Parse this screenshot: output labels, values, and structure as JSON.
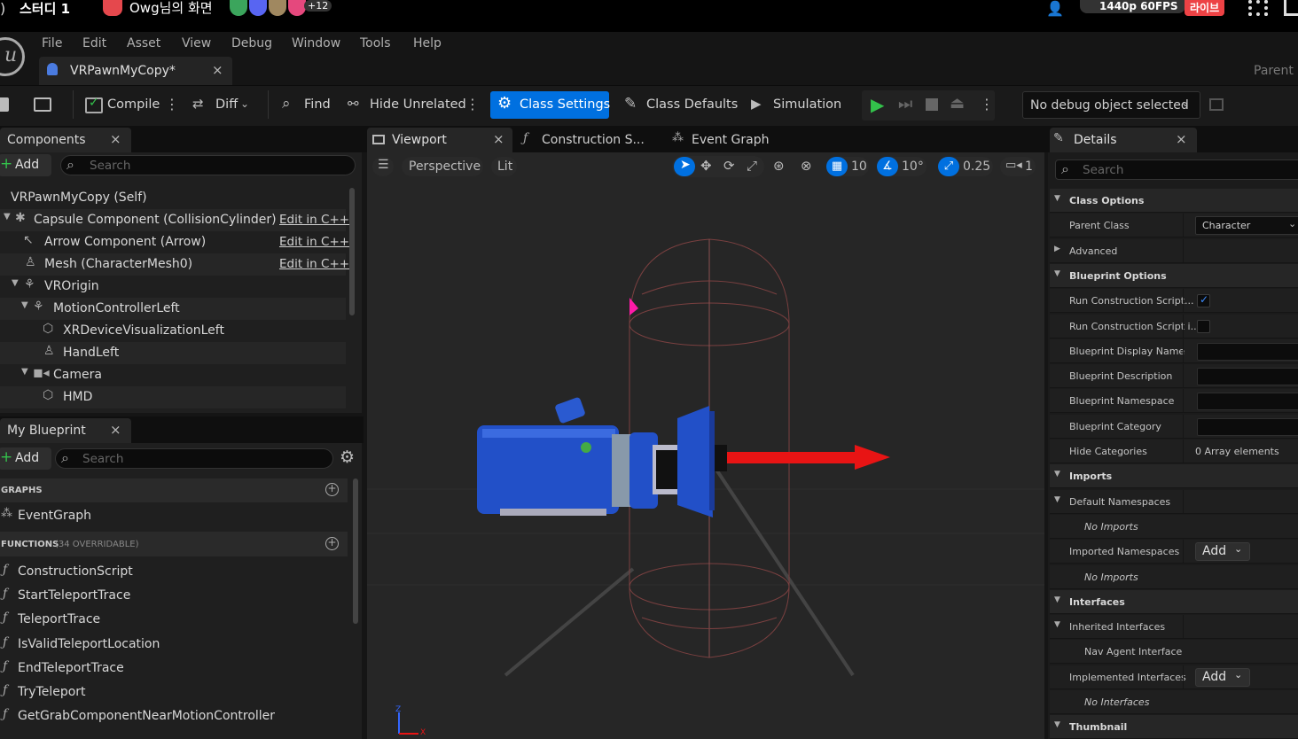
{
  "discord": {
    "channel": "스터디 1",
    "screen_label": "Owg님의 화면",
    "viewer_count": "+12",
    "quality_badge": "1440p 60FPS",
    "live_badge": "라이브"
  },
  "menu": {
    "items": [
      "File",
      "Edit",
      "Asset",
      "View",
      "Debug",
      "Window",
      "Tools",
      "Help"
    ]
  },
  "doc_tab": {
    "label": "VRPawnMyCopy*",
    "close": "×",
    "parent_label": "Parent c"
  },
  "toolbar": {
    "compile": "Compile",
    "diff": "Diff",
    "find": "Find",
    "hide_unrelated": "Hide Unrelated",
    "class_settings": "Class Settings",
    "class_defaults": "Class Defaults",
    "simulation": "Simulation",
    "debug_object": "No debug object selected"
  },
  "components_panel": {
    "title": "Components",
    "close": "×",
    "add": "Add",
    "search_placeholder": "Search",
    "items": [
      {
        "label": "VRPawnMyCopy (Self)",
        "edit": ""
      },
      {
        "label": "Capsule Component (CollisionCylinder)",
        "edit": "Edit in C++"
      },
      {
        "label": "Arrow Component (Arrow)",
        "edit": "Edit in C++"
      },
      {
        "label": "Mesh (CharacterMesh0)",
        "edit": "Edit in C++"
      },
      {
        "label": "VROrigin",
        "edit": ""
      },
      {
        "label": "MotionControllerLeft",
        "edit": ""
      },
      {
        "label": "XRDeviceVisualizationLeft",
        "edit": ""
      },
      {
        "label": "HandLeft",
        "edit": ""
      },
      {
        "label": "Camera",
        "edit": ""
      },
      {
        "label": "HMD",
        "edit": ""
      }
    ]
  },
  "my_blueprint": {
    "title": "My Blueprint",
    "close": "×",
    "add": "Add",
    "search_placeholder": "Search",
    "graphs_header": "GRAPHS",
    "event_graph": "EventGraph",
    "functions_header": "FUNCTIONS",
    "functions_count": "(34 OVERRIDABLE)",
    "functions": [
      "ConstructionScript",
      "StartTeleportTrace",
      "TeleportTrace",
      "IsValidTeleportLocation",
      "EndTeleportTrace",
      "TryTeleport",
      "GetGrabComponentNearMotionController"
    ]
  },
  "editor_tabs": {
    "viewport": "Viewport",
    "close": "×",
    "construction": "Construction S...",
    "event_graph": "Event Graph"
  },
  "viewport": {
    "perspective": "Perspective",
    "lit": "Lit",
    "grid_snap": "10",
    "rot_snap": "10°",
    "scale_snap": "0.25",
    "cam_speed": "1",
    "axis_x": "X",
    "axis_z": "Z"
  },
  "details": {
    "title": "Details",
    "close": "×",
    "search_placeholder": "Search",
    "rows": [
      {
        "label": "Class Options",
        "type": "header",
        "value": ""
      },
      {
        "label": "Parent Class",
        "type": "combo",
        "value": "Character"
      },
      {
        "label": "Advanced",
        "type": "collapsed",
        "value": ""
      },
      {
        "label": "Blueprint Options",
        "type": "header",
        "value": ""
      },
      {
        "label": "Run Construction Script...",
        "type": "check_on",
        "value": ""
      },
      {
        "label": "Run Construction Script i...",
        "type": "check_off",
        "value": ""
      },
      {
        "label": "Blueprint Display Name",
        "type": "text",
        "value": ""
      },
      {
        "label": "Blueprint Description",
        "type": "text",
        "value": ""
      },
      {
        "label": "Blueprint Namespace",
        "type": "text",
        "value": ""
      },
      {
        "label": "Blueprint Category",
        "type": "text",
        "value": ""
      },
      {
        "label": "Hide Categories",
        "type": "static",
        "value": "0 Array elements"
      },
      {
        "label": "Imports",
        "type": "header",
        "value": ""
      },
      {
        "label": "Default Namespaces",
        "type": "sub",
        "value": ""
      },
      {
        "label": "No Imports",
        "type": "italic",
        "value": ""
      },
      {
        "label": "Imported Namespaces",
        "type": "add",
        "value": "Add"
      },
      {
        "label": "No Imports",
        "type": "italic",
        "value": ""
      },
      {
        "label": "Interfaces",
        "type": "header",
        "value": ""
      },
      {
        "label": "Inherited Interfaces",
        "type": "sub",
        "value": ""
      },
      {
        "label": "Nav Agent Interface",
        "type": "indent",
        "value": ""
      },
      {
        "label": "Implemented Interfaces",
        "type": "add",
        "value": "Add"
      },
      {
        "label": "No Interfaces",
        "type": "italic",
        "value": ""
      },
      {
        "label": "Thumbnail",
        "type": "header",
        "value": ""
      }
    ]
  },
  "colors": {
    "accent": "#0070e0",
    "viewport_bg": "#262626",
    "gizmo_red": "#e81414",
    "mesh_blue": "#2250c8"
  }
}
